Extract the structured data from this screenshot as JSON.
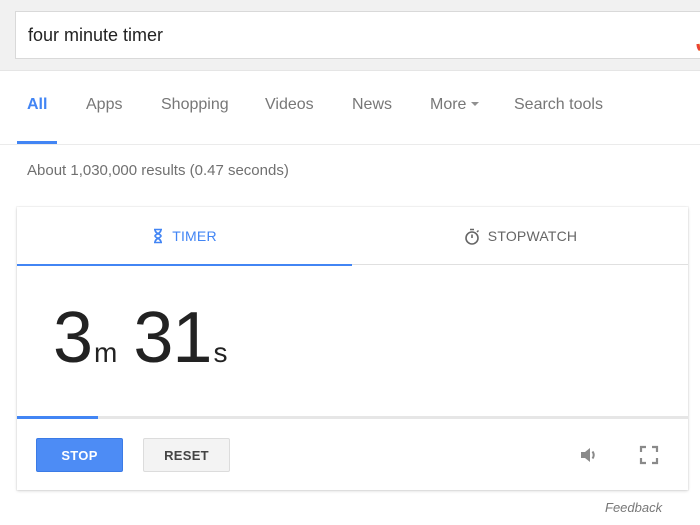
{
  "search": {
    "query": "four minute timer",
    "mic_icon": "microphone-icon"
  },
  "nav": {
    "tabs": [
      {
        "label": "All",
        "active": true
      },
      {
        "label": "Apps",
        "active": false
      },
      {
        "label": "Shopping",
        "active": false
      },
      {
        "label": "Videos",
        "active": false
      },
      {
        "label": "News",
        "active": false
      },
      {
        "label": "More",
        "active": false,
        "has_dropdown": true
      },
      {
        "label": "Search tools",
        "active": false
      }
    ]
  },
  "results_stats": "About 1,030,000 results (0.47 seconds)",
  "timer_widget": {
    "tabs": [
      {
        "label": "TIMER",
        "icon": "hourglass-icon",
        "active": true
      },
      {
        "label": "STOPWATCH",
        "icon": "stopwatch-icon",
        "active": false
      }
    ],
    "remaining": {
      "minutes": "3",
      "minutes_unit": "m",
      "seconds": "31",
      "seconds_unit": "s"
    },
    "progress_fraction": 0.121,
    "buttons": {
      "stop_label": "STOP",
      "reset_label": "RESET"
    },
    "icons": [
      "volume-icon",
      "fullscreen-icon"
    ]
  },
  "feedback_label": "Feedback",
  "colors": {
    "accent": "#4285f4",
    "stop_button": "#4d8cf5",
    "muted_text": "#777777"
  }
}
